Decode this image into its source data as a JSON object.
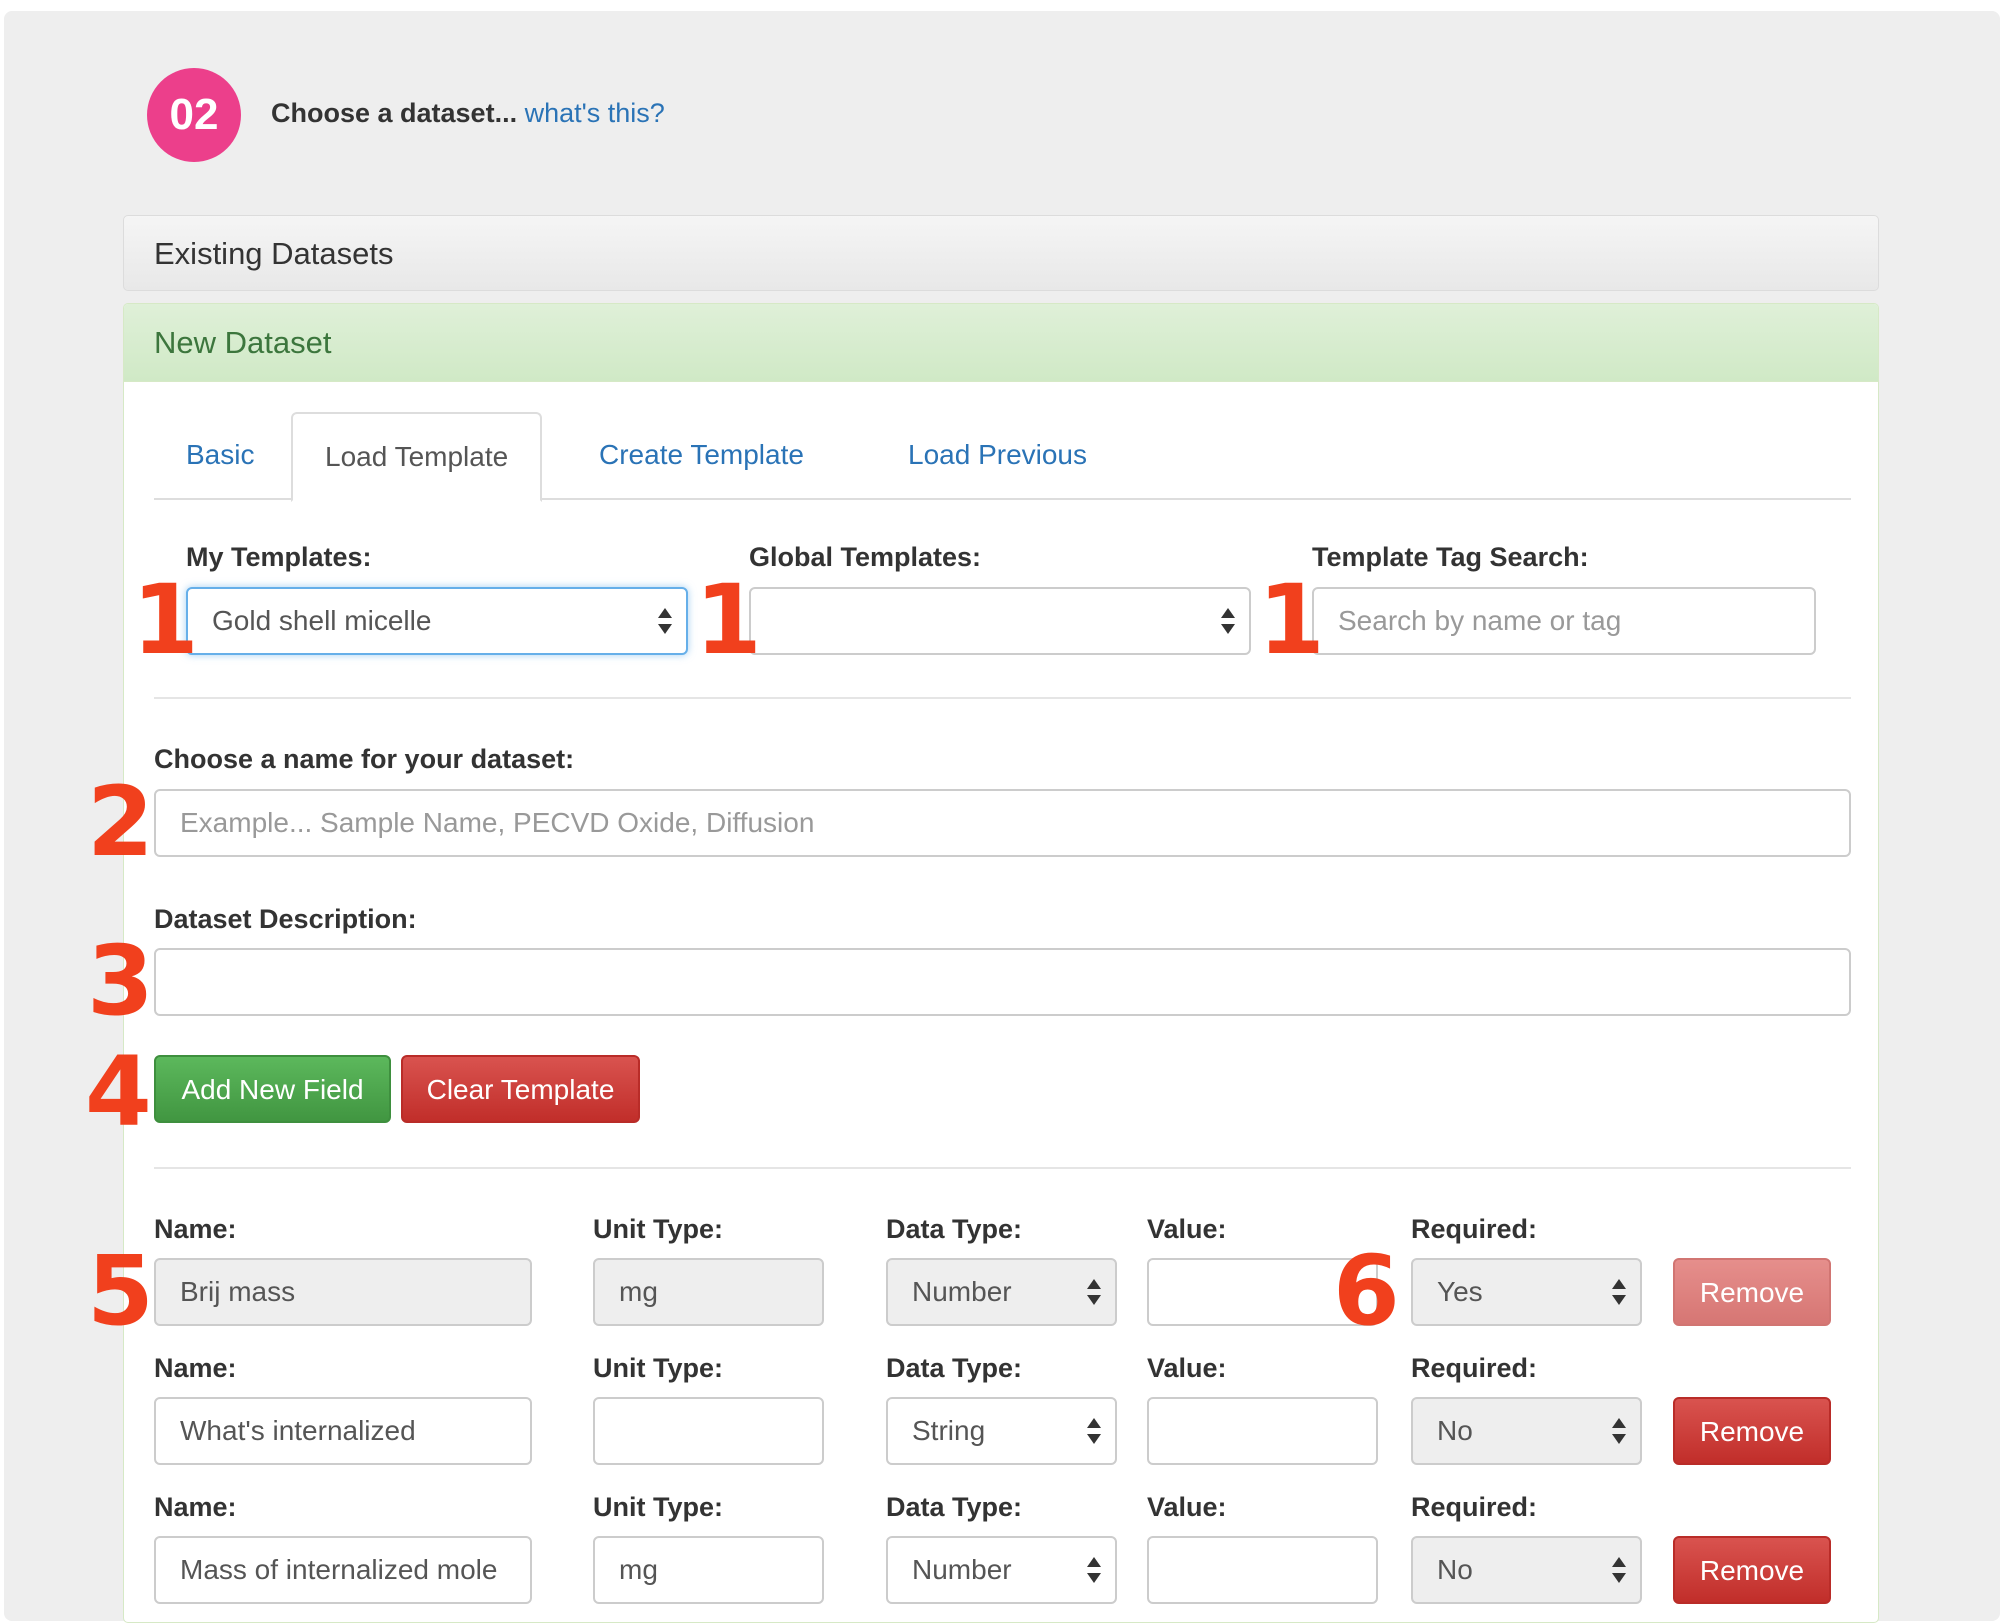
{
  "step": {
    "number": "02",
    "heading": "Choose a dataset...",
    "help_link": "what's this?"
  },
  "panels": {
    "existing_title": "Existing Datasets",
    "new_title": "New Dataset"
  },
  "tabs": [
    {
      "label": "Basic",
      "active": false
    },
    {
      "label": "Load Template",
      "active": true
    },
    {
      "label": "Create Template",
      "active": false
    },
    {
      "label": "Load Previous",
      "active": false
    }
  ],
  "templates": {
    "my_label": "My Templates:",
    "my_value": "Gold shell micelle",
    "global_label": "Global Templates:",
    "global_value": "",
    "tag_label": "Template Tag Search:",
    "tag_placeholder": "Search by name or tag"
  },
  "dataset": {
    "name_label": "Choose a name for your dataset:",
    "name_placeholder": "Example... Sample Name, PECVD Oxide, Diffusion",
    "desc_label": "Dataset Description:",
    "desc_value": ""
  },
  "buttons": {
    "add_field": "Add New Field",
    "clear_template": "Clear Template"
  },
  "field_labels": {
    "name": "Name:",
    "unit": "Unit Type:",
    "data_type": "Data Type:",
    "value": "Value:",
    "required": "Required:",
    "remove": "Remove"
  },
  "fields": [
    {
      "name": "Brij mass",
      "unit": "mg",
      "data_type": "Number",
      "value": "",
      "required": "Yes",
      "locked": true
    },
    {
      "name": "What's internalized",
      "unit": "",
      "data_type": "String",
      "value": "",
      "required": "No",
      "locked": false
    },
    {
      "name": "Mass of internalized mole",
      "unit": "mg",
      "data_type": "Number",
      "value": "",
      "required": "No",
      "locked": false
    }
  ],
  "annotations": [
    "1",
    "1",
    "1",
    "2",
    "3",
    "4",
    "5",
    "6"
  ],
  "colors": {
    "step_circle": "#ec3f8b",
    "link": "#2a73b6",
    "success": "#5cb85c",
    "danger": "#d9534f",
    "annotation": "#f1401d",
    "new_panel_header": "#dff0d8"
  }
}
